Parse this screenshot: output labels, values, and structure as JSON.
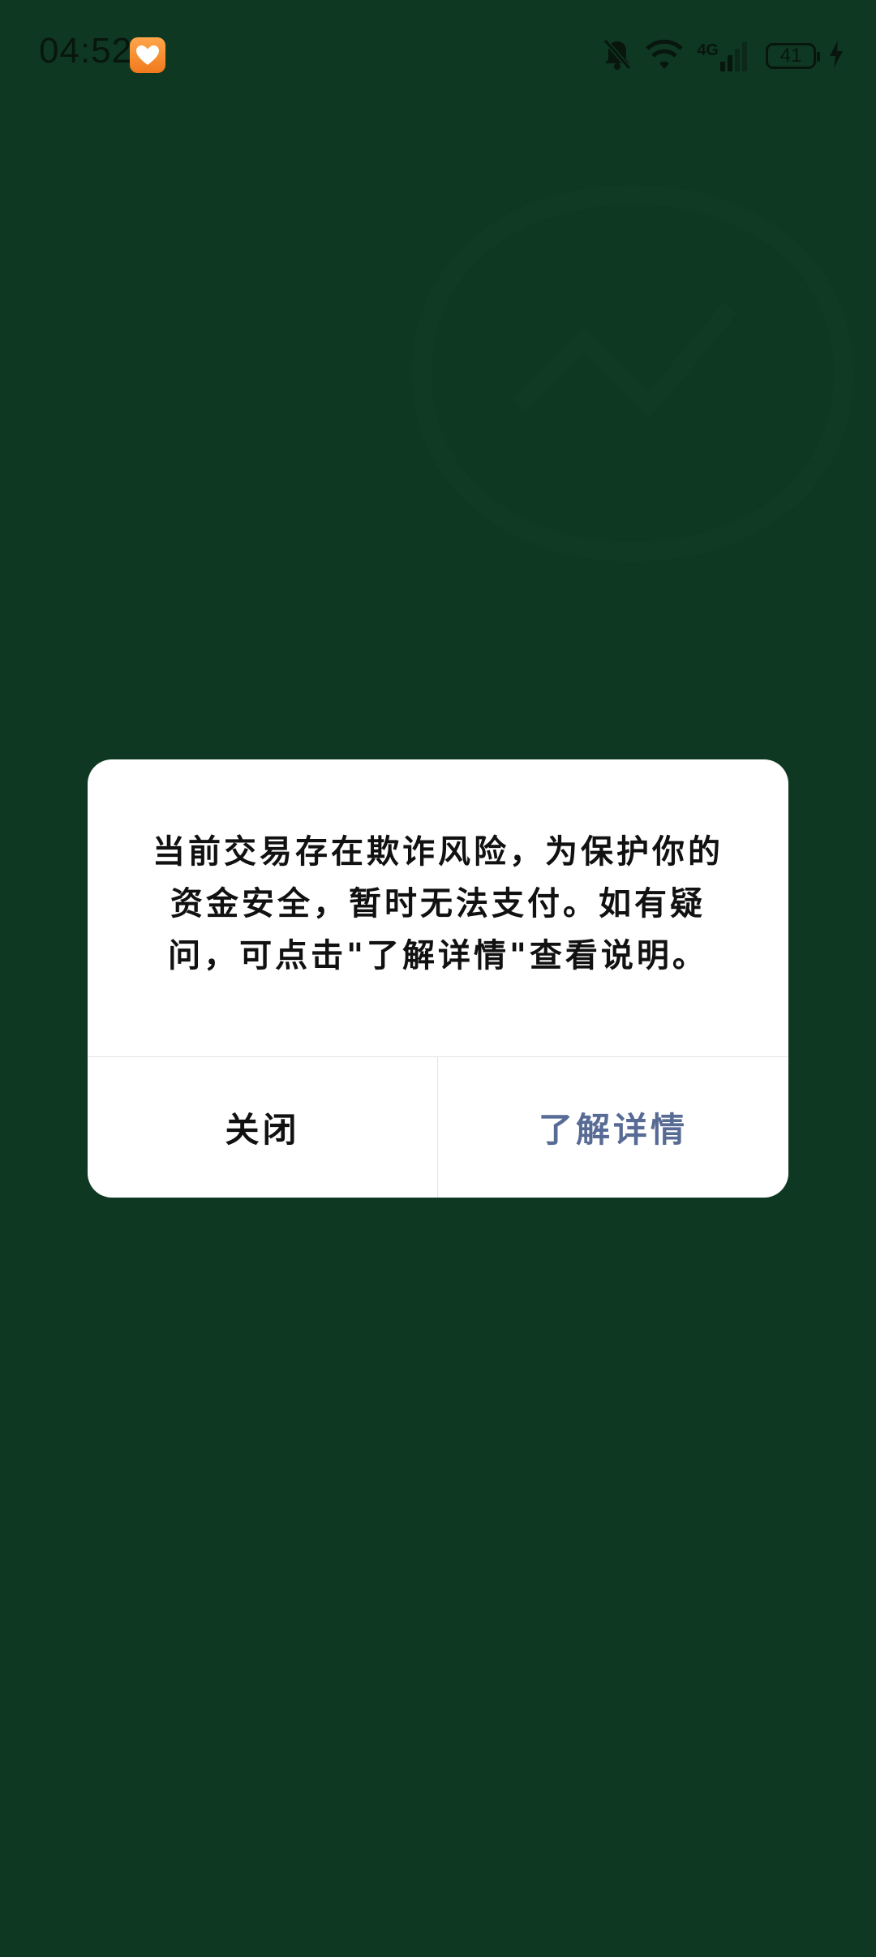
{
  "status_bar": {
    "time": "04:52",
    "network_type": "4G",
    "battery_level": "41"
  },
  "dialog": {
    "message": "当前交易存在欺诈风险，为保护你的资金安全，暂时无法支付。如有疑问，可点击\"了解详情\"查看说明。",
    "close_label": "关闭",
    "details_label": "了解详情"
  },
  "colors": {
    "background": "#0f3823",
    "dialog_bg": "#ffffff",
    "link": "#576b95"
  }
}
